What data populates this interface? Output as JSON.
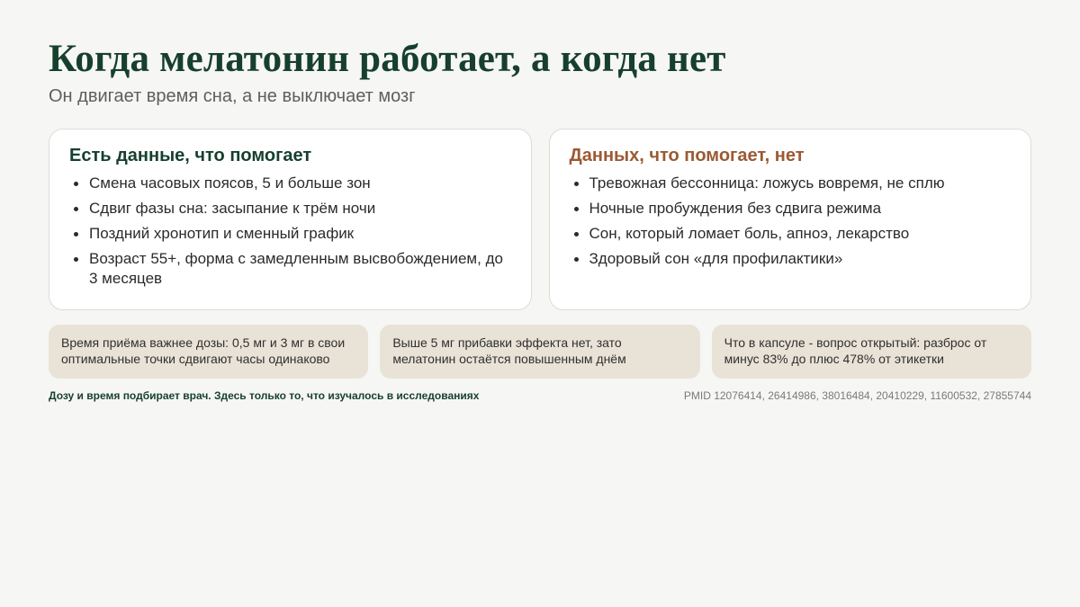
{
  "title": "Когда мелатонин работает, а когда нет",
  "subtitle": "Он двигает время сна, а не выключает мозг",
  "cards": [
    {
      "title": "Есть данные, что помогает",
      "items": [
        "Смена часовых поясов, 5 и больше зон",
        "Сдвиг фазы сна: засыпание к трём ночи",
        "Поздний хронотип и сменный график",
        "Возраст 55+, форма с замедленным высвобождением, до 3 месяцев"
      ]
    },
    {
      "title": "Данных, что помогает, нет",
      "items": [
        "Тревожная бессонница: ложусь вовремя, не сплю",
        "Ночные пробуждения без сдвига режима",
        "Сон, который ломает боль, апноэ, лекарство",
        "Здоровый сон «для профилактики»"
      ]
    }
  ],
  "notes": [
    "Время приёма важнее дозы: 0,5 мг и 3 мг в свои оптимальные точки сдвигают часы одинаково",
    "Выше 5 мг прибавки эффекта нет, зато мелатонин остаётся повышенным днём",
    "Что в капсуле - вопрос открытый: разброс от минус 83% до плюс 478% от этикетки"
  ],
  "footer": {
    "note": "Дозу и время подбирает врач. Здесь только то, что изучалось в исследованиях",
    "refs": "PMID 12076414, 26414986, 38016484, 20410229, 11600532, 27855744"
  },
  "colors": {
    "accent_green": "#163f2e",
    "accent_brown": "#9a5a34",
    "note_bg": "#e8e3d6",
    "page_bg": "#f6f6f4"
  }
}
